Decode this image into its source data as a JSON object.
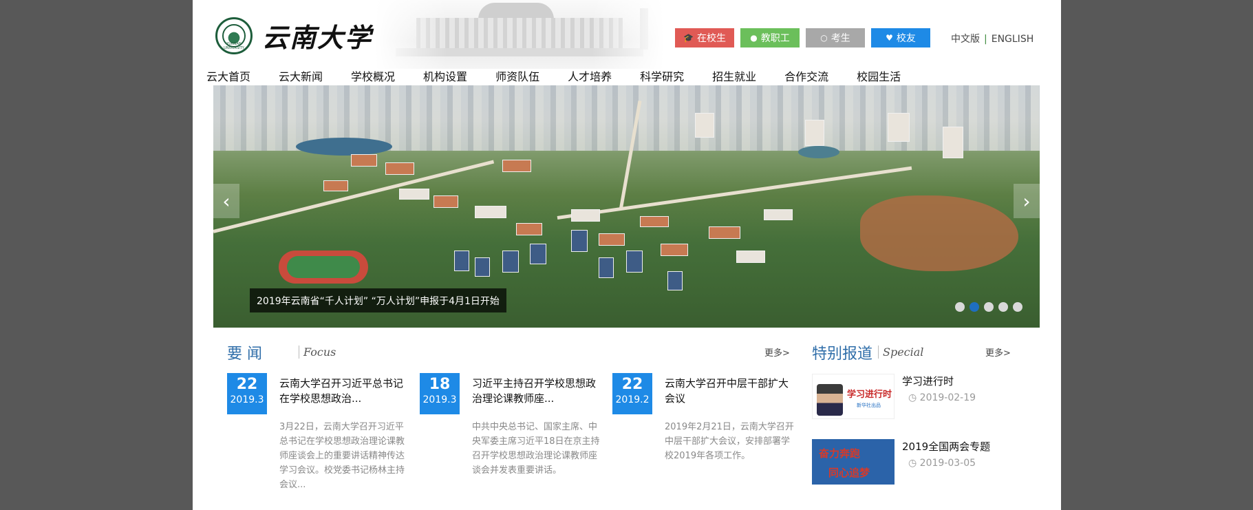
{
  "header": {
    "logo_text": "云南大学",
    "seal_text": "YUNNAN UNIVERSITY",
    "quick_links": [
      {
        "label": "在校生",
        "icon": "graduation-cap-icon",
        "color": "#e05a55"
      },
      {
        "label": "教职工",
        "icon": "user-icon",
        "color": "#6bbf5b"
      },
      {
        "label": "考生",
        "icon": "user-outline-icon",
        "color": "#a8a8a8"
      },
      {
        "label": "校友",
        "icon": "heart-icon",
        "color": "#1e8ae6"
      }
    ],
    "lang": {
      "chinese": "中文版",
      "separator": "|",
      "english": "ENGLISH"
    }
  },
  "nav": [
    "云大首页",
    "云大新闻",
    "学校概况",
    "机构设置",
    "师资队伍",
    "人才培养",
    "科学研究",
    "招生就业",
    "合作交流",
    "校园生活"
  ],
  "banner": {
    "caption": "2019年云南省“千人计划” “万人计划”申报于4月1日开始",
    "prev": "‹",
    "next": "›",
    "dots_count": 5,
    "active_dot": 2
  },
  "news": {
    "title": "要 闻",
    "subtitle": "Focus",
    "more": "更多>",
    "items": [
      {
        "day": "22",
        "month": "2019.3",
        "title": "云南大学召开习近平总书记在学校思想政治...",
        "summary": " 3月22日，云南大学召开习近平总书记在学校思想政治理论课教师座谈会上的重要讲话精神传达学习会议。校党委书记杨林主持会议..."
      },
      {
        "day": "18",
        "month": "2019.3",
        "title": "习近平主持召开学校思想政治理论课教师座...",
        "summary": "中共中央总书记、国家主席、中央军委主席习近平18日在京主持召开学校思想政治理论课教师座谈会并发表重要讲话。"
      },
      {
        "day": "22",
        "month": "2019.2",
        "title": "云南大学召开中层干部扩大会议",
        "summary": "2019年2月21日，云南大学召开中层干部扩大会议，安排部署学校2019年各项工作。"
      }
    ]
  },
  "special": {
    "title": "特别报道",
    "subtitle": "Special",
    "more": "更多>",
    "items": [
      {
        "title": "学习进行时",
        "date": "2019-02-19",
        "thumb_main": "学习进行时",
        "thumb_sub": "新华社出品"
      },
      {
        "title": "2019全国两会专题",
        "date": "2019-03-05",
        "thumb_line1": "奋力奔跑",
        "thumb_line2": "同心追梦"
      }
    ]
  }
}
